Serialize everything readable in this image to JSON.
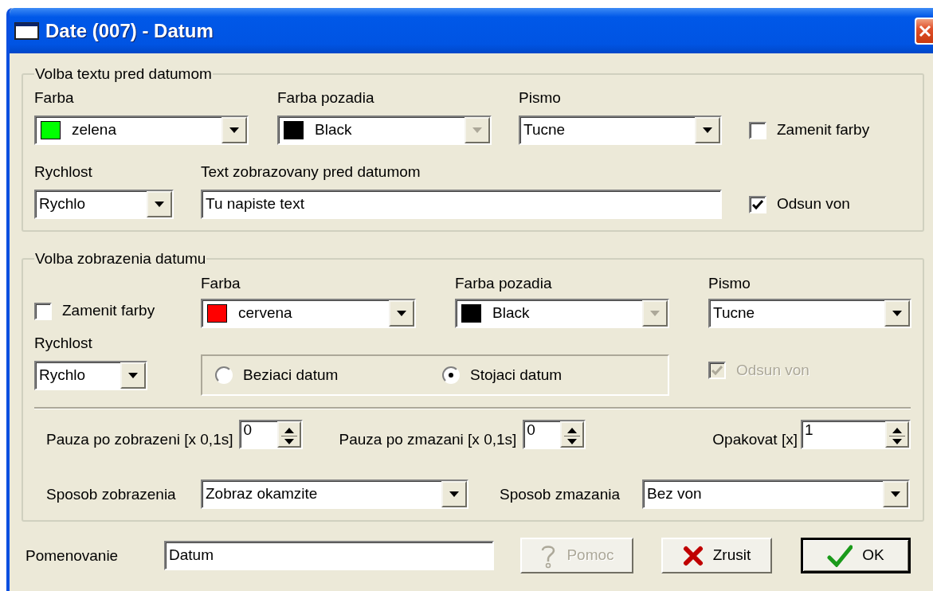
{
  "window": {
    "title": "Date (007) - Datum"
  },
  "text_group": {
    "legend": "Volba textu pred datumom",
    "color": {
      "label": "Farba",
      "value": "zelena",
      "color": "#00ff00",
      "disabled": false
    },
    "background": {
      "label": "Farba pozadia",
      "value": "Black",
      "color": "#000000",
      "disabled": true
    },
    "font": {
      "label": "Pismo",
      "value": "Tucne",
      "disabled": false
    },
    "swap_colors": {
      "label": "Zamenit farby",
      "checked": false,
      "disabled": false
    },
    "speed": {
      "label": "Rychlost",
      "value": "Rychlo",
      "disabled": false
    },
    "text": {
      "label": "Text zobrazovany pred datumom",
      "value": "Tu napiste text"
    },
    "push_out": {
      "label": "Odsun von",
      "checked": true,
      "disabled": false
    }
  },
  "date_group": {
    "legend": "Volba zobrazenia datumu",
    "swap_colors": {
      "label": "Zamenit farby",
      "checked": false,
      "disabled": false
    },
    "color": {
      "label": "Farba",
      "value": "cervena",
      "color": "#ff0000",
      "disabled": false
    },
    "background": {
      "label": "Farba pozadia",
      "value": "Black",
      "color": "#000000",
      "disabled": true
    },
    "font": {
      "label": "Pismo",
      "value": "Tucne",
      "disabled": false
    },
    "speed": {
      "label": "Rychlost",
      "value": "Rychlo",
      "disabled": false
    },
    "mode_options": [
      {
        "label": "Beziaci datum",
        "selected": false
      },
      {
        "label": "Stojaci datum",
        "selected": true
      }
    ],
    "push_out": {
      "label": "Odsun von",
      "checked": true,
      "disabled": true
    },
    "pause_after_show": {
      "label": "Pauza po zobrazeni [x 0,1s]",
      "value": "0"
    },
    "pause_after_erase": {
      "label": "Pauza po zmazani [x 0,1s]",
      "value": "0"
    },
    "repeat": {
      "label": "Opakovat [x]",
      "value": "1"
    },
    "show_mode": {
      "label": "Sposob zobrazenia",
      "value": "Zobraz okamzite",
      "disabled": false
    },
    "erase_mode": {
      "label": "Sposob zmazania",
      "value": "Bez von",
      "disabled": false
    }
  },
  "name": {
    "label": "Pomenovanie",
    "value": "Datum"
  },
  "buttons": [
    {
      "label": "Pomoc",
      "kind": "help",
      "disabled": true,
      "default": false
    },
    {
      "label": "Zrusit",
      "kind": "cancel",
      "disabled": false,
      "default": false
    },
    {
      "label": "OK",
      "kind": "ok",
      "disabled": false,
      "default": true
    }
  ]
}
